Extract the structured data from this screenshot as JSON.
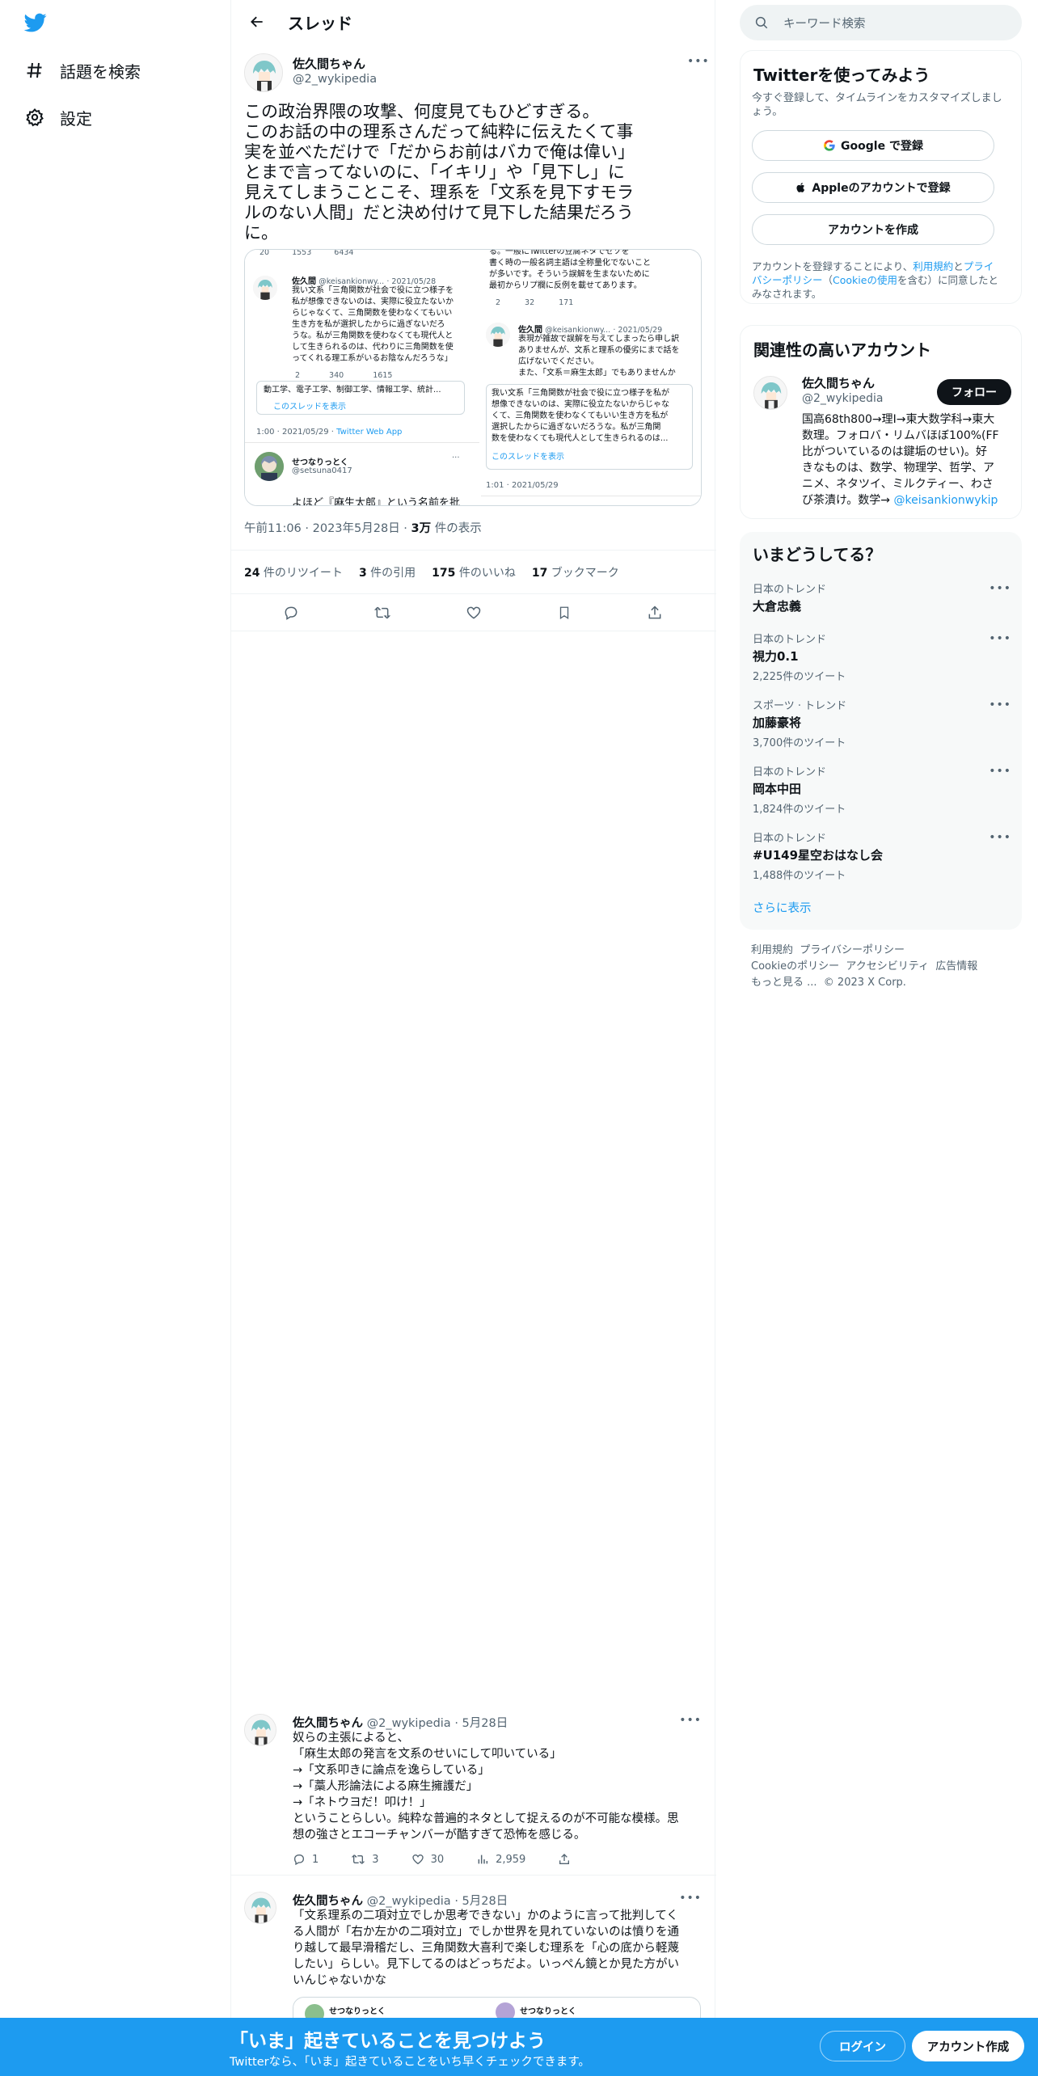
{
  "nav": {
    "items": [
      {
        "label": "話題を検索",
        "icon": "hashtag-icon"
      },
      {
        "label": "設定",
        "icon": "gear-icon"
      }
    ]
  },
  "header": {
    "title": "スレッド"
  },
  "main_tweet": {
    "display_name": "佐久間ちゃん",
    "handle": "@2_wykipedia",
    "text_lines": [
      "この政治界隈の攻撃、何度見てもひどすぎる。",
      "このお話の中の理系さんだって純粋に伝えたくて事",
      "実を並べただけで「だからお前はバカで俺は偉い」",
      "とまで言ってないのに、「イキリ」や「見下し」に",
      "見えてしまうことこそ、理系を「文系を見下すモラ",
      "ルのない人間」だと決め付けて見下した結果だろう",
      "に。"
    ],
    "time": "午前11:06",
    "date": "2023年5月28日",
    "views_count": "3万",
    "views_label": " 件の表示",
    "stats": [
      {
        "n": "24",
        "label": " 件のリツイート"
      },
      {
        "n": "3",
        "label": " 件の引用"
      },
      {
        "n": "175",
        "label": " 件のいいね"
      },
      {
        "n": "17",
        "label": " ブックマーク"
      }
    ]
  },
  "media": {
    "left": {
      "top_counts": [
        "20",
        "1553",
        "6434"
      ],
      "name": "佐久間",
      "handle": "@keisankionwy...",
      "date": "· 2021/05/28",
      "lines": [
        "我い文系「三角関数が社会で役に立つ様子を",
        "私が想像できないのは、実際に役立たないか",
        "らじゃなくて、三角関数を使わなくてもいい",
        "生き方を私が選択したからに過ぎないだろ",
        "うな。私が三角関数を使わなくても現代人と",
        "して生きられるのは、代わりに三角関数を使",
        "ってくれる理工系がいるお陰なんだろうな」"
      ],
      "counts": [
        "2",
        "340",
        "1615"
      ],
      "quoted_line": "動工学、電子工学、制御工学、情報工学、統計...",
      "thread_link": "このスレッドを表示",
      "footer_date": "1:00 · 2021/05/29 · ",
      "footer_client": "Twitter Web App",
      "user2_name": "せつなりっとく",
      "user2_handle": "@setsuna0417",
      "bottom_line": "よほど『麻生太郎』という名前を批"
    },
    "right": {
      "top_lines": [
        "る。一般にTwitterの豆腐ネタでセソを",
        "書く時の一般名詞主語は全称量化でないこと",
        "が多いです。そういう誤解を生まないために",
        "最初からリプ欄に反例を載せてあります。"
      ],
      "top_counts": [
        "2",
        "32",
        "171"
      ],
      "name": "佐久間",
      "handle": "@keisankionwy...",
      "date": "· 2021/05/29",
      "lines": [
        "表現が雑故で誤解を与えてしまったら申し訳",
        "ありませんが、文系と理系の優劣にまで話を",
        "広げないでください。",
        "また、「文系＝麻生太郎」でもありませんか"
      ],
      "quote_lines": [
        "我い文系「三角関数が社会で役に立つ様子を私が",
        "想像できないのは、実際に役立たないからじゃな",
        "くて、三角関数を使わなくてもいい生き方を私が",
        "選択したからに過ぎないだろうな。私が三角関",
        "数を使わなくても現代人として生きられるのは..."
      ],
      "thread_link": "このスレッドを表示",
      "footer_date": "1:01 · 2021/05/29"
    }
  },
  "replies": [
    {
      "display_name": "佐久間ちゃん",
      "handle": "@2_wykipedia",
      "date": "· 5月28日",
      "lines": [
        "奴らの主張によると、",
        "「麻生太郎の発言を文系のせいにして叩いている」",
        "→「文系叩きに論点を逸らしている」",
        "→「藁人形論法による麻生擁護だ」",
        "→「ネトウヨだ！叩け！」",
        "ということらしい。純粋な普遍的ネタとして捉えるのが不可能な模様。思",
        "想の強さとエコーチャンバーが酷すぎて恐怖を感じる。"
      ],
      "counts": {
        "reply": "1",
        "retweet": "3",
        "like": "30",
        "views": "2,959"
      }
    },
    {
      "display_name": "佐久間ちゃん",
      "handle": "@2_wykipedia",
      "date": "· 5月28日",
      "lines": [
        "「文系理系の二項対立でしか思考できない」かのように言って批判してく",
        "る人間が「右か左かの二項対立」でしか世界を見れていないのは憤りを通",
        "り越して最早滑稽だし、三角関数大喜利で楽しむ理系を「心の底から軽蔑",
        "したい」らしい。見下してるのはどっちだよ。いっぺん鏡とか見た方がい",
        "いんじゃないかな"
      ],
      "embed_names": [
        "せつなりっとく",
        "せつなりっとく"
      ]
    }
  ],
  "sidebar": {
    "search_placeholder": "キーワード検索",
    "signup_card": {
      "title": "Twitterを使ってみよう",
      "subtitle_lines": [
        "今すぐ登録して、タイムラインをカスタマイズしまし",
        "ょう。"
      ],
      "google_label": "Google で登録",
      "apple_label": "Appleのアカウントで登録",
      "create_label": "アカウントを作成",
      "terms_1": "アカウントを登録することにより、",
      "terms_link1": "利用規約",
      "terms_2": "と",
      "terms_link2": "プライ",
      "terms_link2b": "バシーポリシー",
      "terms_3": "（",
      "terms_link3": "Cookieの使用",
      "terms_4": "を含む）に同意したと",
      "terms_5": "みなされます。"
    },
    "related": {
      "title": "関連性の高いアカウント",
      "name": "佐久間ちゃん",
      "handle": "@2_wykipedia",
      "follow_label": "フォロー",
      "bio_lines": [
        "国高68th800→理I→東大数学科→東大",
        "数理。フォロバ・リムバほぼ100%(FF",
        "比がついているのは鍵垢のせい)。好",
        "きなものは、数学、物理学、哲学、ア",
        "ニメ、ネタツイ、ミルクティー、わさ",
        "び茶漬け。数学→ "
      ],
      "bio_link": "@keisankionwykip"
    },
    "trends": {
      "title": "いまどうしてる？",
      "items": [
        {
          "cat": "日本のトレンド",
          "name": "大倉忠義",
          "count": ""
        },
        {
          "cat": "日本のトレンド",
          "name": "視力0.1",
          "count": "2,225件のツイート"
        },
        {
          "cat": "スポーツ · トレンド",
          "name": "加藤豪将",
          "count": "3,700件のツイート"
        },
        {
          "cat": "日本のトレンド",
          "name": "岡本中田",
          "count": "1,824件のツイート"
        },
        {
          "cat": "日本のトレンド",
          "name": "#U149星空おはなし会",
          "count": "1,488件のツイート"
        }
      ],
      "show_more": "さらに表示"
    },
    "footer": {
      "line1": [
        "利用規約",
        "プライバシーポリシー"
      ],
      "line2": [
        "Cookieのポリシー",
        "アクセシビリティ",
        "広告情報"
      ],
      "line3": [
        "もっと見る ...",
        "© 2023 X Corp."
      ]
    }
  },
  "bottom_bar": {
    "title": "「いま」起きていることを見つけよう",
    "subtitle": "Twitterなら、「いま」起きていることをいち早くチェックできます。",
    "login_label": "ログイン",
    "signup_label": "アカウント作成"
  },
  "colors": {
    "accent": "#1d9bf0",
    "text": "#0f1419",
    "secondary": "#536471"
  }
}
